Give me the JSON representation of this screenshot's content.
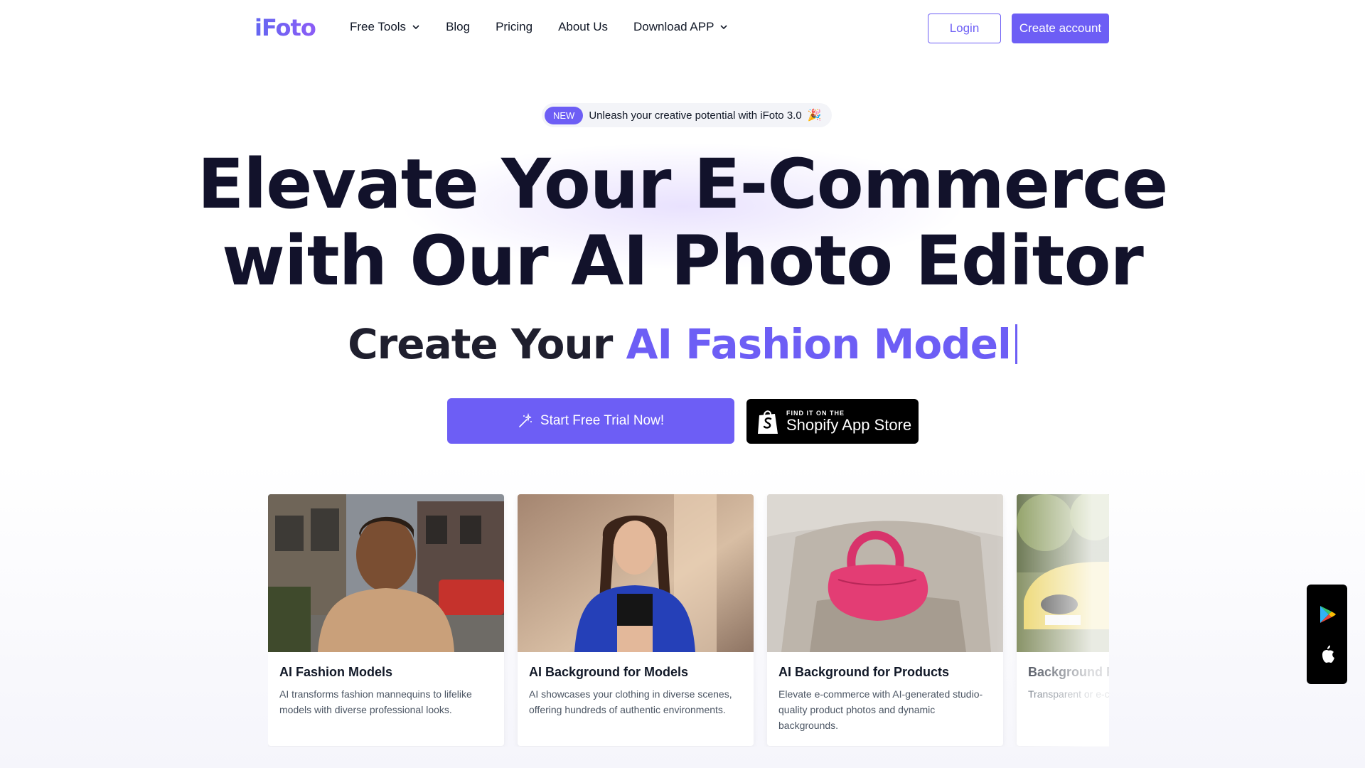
{
  "header": {
    "logo": "iFoto",
    "nav": [
      {
        "label": "Free Tools",
        "has_dropdown": true
      },
      {
        "label": "Blog",
        "has_dropdown": false
      },
      {
        "label": "Pricing",
        "has_dropdown": false
      },
      {
        "label": "About Us",
        "has_dropdown": false
      },
      {
        "label": "Download APP",
        "has_dropdown": true
      }
    ],
    "login_label": "Login",
    "create_label": "Create account"
  },
  "announcement": {
    "badge": "NEW",
    "text": "Unleash your creative potential with iFoto 3.0",
    "emoji": "🎉"
  },
  "hero": {
    "title_line1": "Elevate Your E-Commerce",
    "title_line2": "with Our AI Photo Editor",
    "subtitle_prefix": "Create Your ",
    "subtitle_accent": "AI Fashion Model"
  },
  "cta": {
    "trial_label": "Start Free Trial Now!",
    "shopify_small": "FIND IT ON THE",
    "shopify_big": "Shopify App Store"
  },
  "cards": [
    {
      "title": "AI Fashion Models",
      "desc": "AI transforms fashion mannequins to lifelike models with diverse professional looks."
    },
    {
      "title": "AI Background for Models",
      "desc": "AI showcases your clothing in diverse scenes, offering hundreds of authentic environments."
    },
    {
      "title": "AI Background for Products",
      "desc": "Elevate e-commerce with AI-generated studio-quality product photos and dynamic backgrounds."
    },
    {
      "title": "Background Re",
      "desc": "Transparent or e-c backgrounds com"
    }
  ],
  "side_apps": [
    "google-play-icon",
    "apple-icon"
  ],
  "colors": {
    "accent": "#6d5ef5",
    "heading": "#12122b"
  }
}
